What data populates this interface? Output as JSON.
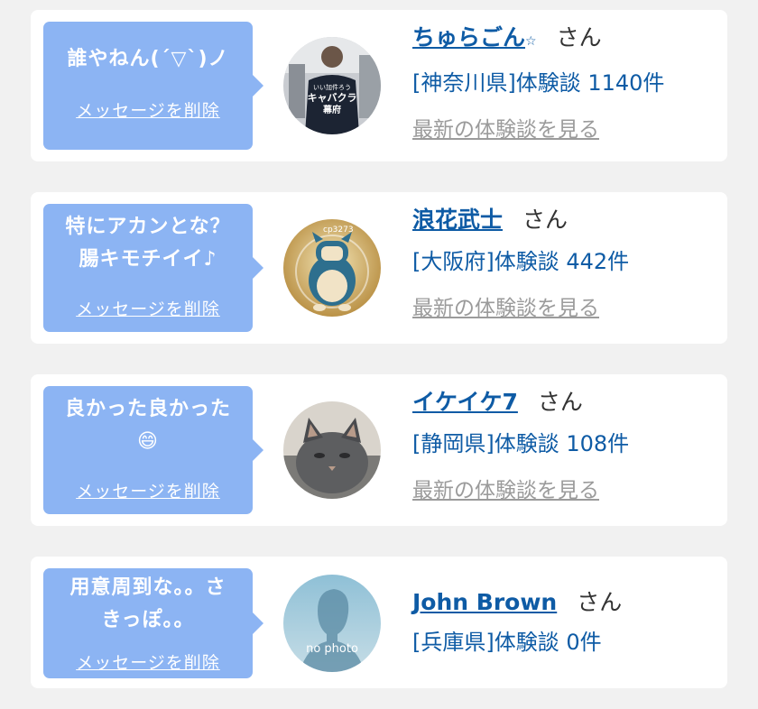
{
  "cards": [
    {
      "message_lines": [
        "誰やねん(´▽`)ノ"
      ],
      "delete_label": "メッセージを削除",
      "name": "ちゅらごん",
      "name_suffix": "☆",
      "san": "さん",
      "prefecture_line": "[神奈川県]体験談 1140件",
      "latest_link": "最新の体験談を見る",
      "avatar_text": [
        "いい加件ろう",
        "キャバクラ",
        "幕府"
      ],
      "avatar_icon": "person-photo"
    },
    {
      "message_lines": [
        "特にアカンとな？",
        "腸キモチイイ♪"
      ],
      "delete_label": "メッセージを削除",
      "name": "浪花武士",
      "san": "さん",
      "prefecture_line": "[大阪府]体験談 442件",
      "latest_link": "最新の体験談を見る",
      "avatar_text": [
        "cp3273"
      ],
      "avatar_icon": "snorlax-photo"
    },
    {
      "message_lines": [
        "良かった良かった",
        "😄"
      ],
      "delete_label": "メッセージを削除",
      "name": "イケイケ7",
      "san": "さん",
      "prefecture_line": "[静岡県]体験談 108件",
      "latest_link": "最新の体験談を見る",
      "avatar_icon": "cat-photo"
    },
    {
      "message_lines": [
        "用意周到な。。さ",
        "きっぽ。。"
      ],
      "delete_label": "メッセージを削除",
      "name": "John Brown",
      "san": "さん",
      "prefecture_line": "[兵庫県]体験談 0件",
      "avatar_text": [
        "no photo"
      ],
      "avatar_icon": "no-photo-silhouette"
    }
  ],
  "colors": {
    "bubble": "#8cb4f3",
    "link": "#0e5ba5",
    "muted_link": "#9b9b9b",
    "background": "#f1f1f1"
  }
}
